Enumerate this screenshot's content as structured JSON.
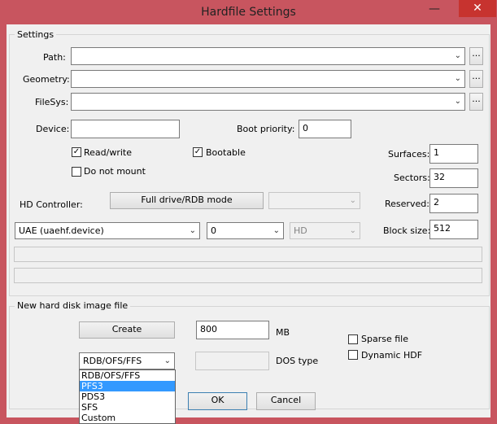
{
  "window": {
    "title": "Hardfile Settings",
    "minimize_glyph": "—",
    "close_glyph": "✕"
  },
  "settings": {
    "group_label": "Settings",
    "path_label": "Path:",
    "geometry_label": "Geometry:",
    "filesys_label": "FileSys:",
    "browse_label": "...",
    "device_label": "Device:",
    "device_value": "",
    "boot_priority_label": "Boot priority:",
    "boot_priority_value": "0",
    "read_write_label": "Read/write",
    "read_write_checked": true,
    "bootable_label": "Bootable",
    "bootable_checked": true,
    "do_not_mount_label": "Do not mount",
    "do_not_mount_checked": false,
    "surfaces_label": "Surfaces:",
    "surfaces_value": "1",
    "sectors_label": "Sectors:",
    "sectors_value": "32",
    "reserved_label": "Reserved:",
    "reserved_value": "2",
    "block_size_label": "Block size:",
    "block_size_value": "512",
    "hd_controller_label": "HD Controller:",
    "full_drive_button": "Full drive/RDB mode",
    "controller_select": "UAE (uaehf.device)",
    "unit_select": "0",
    "type_select": "HD"
  },
  "new_image": {
    "group_label": "New hard disk image file",
    "create_button": "Create",
    "size_value": "800",
    "size_unit": "MB",
    "sparse_label": "Sparse file",
    "dynamic_label": "Dynamic HDF",
    "fs_select": "RDB/OFS/FFS",
    "dos_type_value": "",
    "dos_type_label": "DOS type",
    "dropdown_options": [
      "RDB/OFS/FFS",
      "PFS3",
      "PDS3",
      "SFS",
      "Custom"
    ],
    "dropdown_highlighted": "PFS3"
  },
  "footer": {
    "ok_button": "OK",
    "cancel_button": "Cancel"
  },
  "colors": {
    "titlebar": "#c8555f",
    "close_button": "#c7332f",
    "highlight": "#3399ff"
  }
}
